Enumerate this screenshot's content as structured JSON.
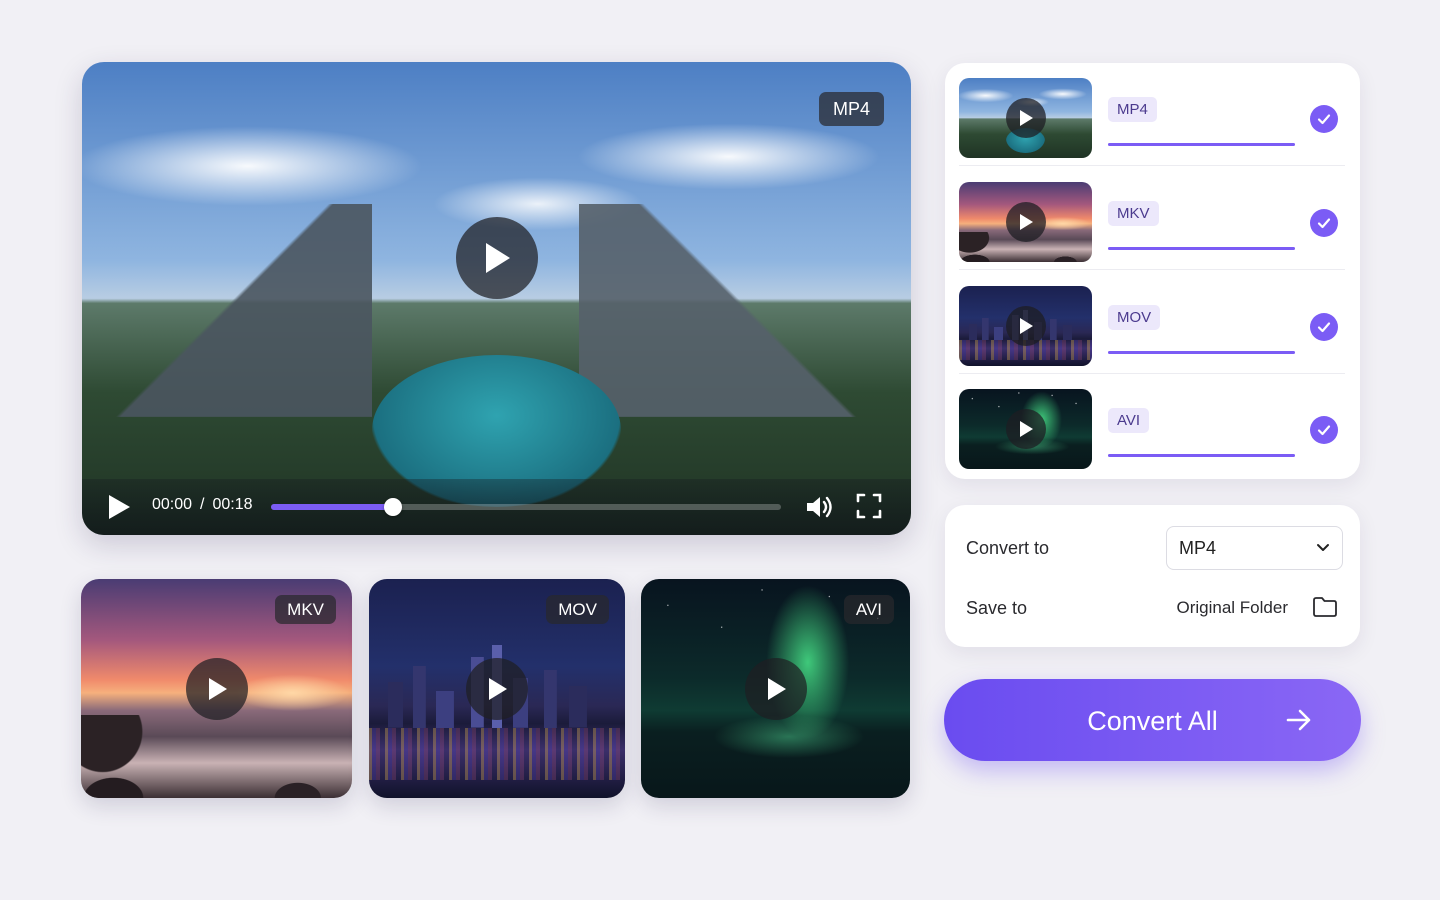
{
  "player": {
    "format_badge": "MP4",
    "time_current": "00:00",
    "time_separator": "/",
    "time_total": "00:18",
    "progress_fraction": 0.24,
    "icons": {
      "play": "play-icon",
      "volume": "volume-icon",
      "fullscreen": "fullscreen-icon"
    }
  },
  "thumbnails": [
    {
      "format": "MKV",
      "scene": "sunset-coast"
    },
    {
      "format": "MOV",
      "scene": "city-night"
    },
    {
      "format": "AVI",
      "scene": "aurora"
    }
  ],
  "queue": [
    {
      "format": "MP4",
      "progress_fraction": 1.0,
      "status": "done",
      "scene": "mountain-lake"
    },
    {
      "format": "MKV",
      "progress_fraction": 1.0,
      "status": "done",
      "scene": "sunset-coast"
    },
    {
      "format": "MOV",
      "progress_fraction": 1.0,
      "status": "done",
      "scene": "city-night"
    },
    {
      "format": "AVI",
      "progress_fraction": 1.0,
      "status": "done",
      "scene": "aurora"
    }
  ],
  "settings": {
    "convert_to_label": "Convert to",
    "convert_to_value": "MP4",
    "save_to_label": "Save to",
    "save_to_value": "Original Folder"
  },
  "convert_button": {
    "label": "Convert All"
  },
  "colors": {
    "accent": "#7b5cf5",
    "page_bg": "#f1f0f5",
    "card_bg": "#ffffff",
    "badge_bg": "#ece8fb"
  }
}
